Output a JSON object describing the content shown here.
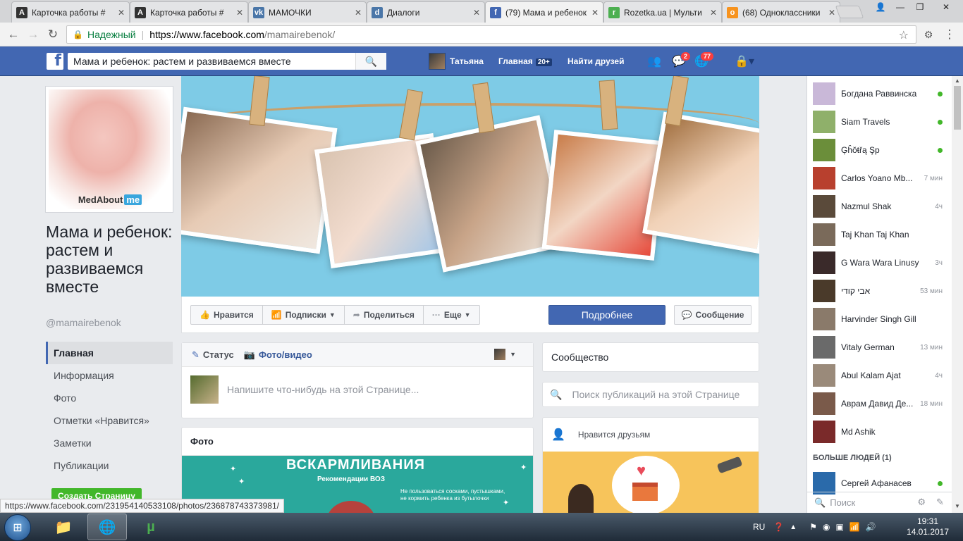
{
  "browser": {
    "tabs": [
      {
        "title": "Карточка работы #",
        "icon": "A",
        "color": "#333333"
      },
      {
        "title": "Карточка работы #",
        "icon": "A",
        "color": "#333333"
      },
      {
        "title": "МАМОЧКИ",
        "icon": "vk",
        "color": "#4a76a8"
      },
      {
        "title": "Диалоги",
        "icon": "d",
        "color": "#4a76a8"
      },
      {
        "title": "(79) Мама и ребенок",
        "icon": "f",
        "color": "#4267b2"
      },
      {
        "title": "Rozetka.ua | Мульти",
        "icon": "r",
        "color": "#4caf50"
      },
      {
        "title": "(68) Одноклассники",
        "icon": "o",
        "color": "#f7931e"
      }
    ],
    "secure_label": "Надежный",
    "url_host": "https://www.facebook.com",
    "url_path": "/mamairebenok/"
  },
  "fb": {
    "search_value": "Мама и ребенок: растем и развиваемся вместе",
    "user_name": "Татьяна",
    "home_label": "Главная",
    "home_badge": "20+",
    "find_friends": "Найти друзей",
    "messages_badge": "2",
    "notifications_badge": "77"
  },
  "page": {
    "profile_brand": "MedAbout",
    "profile_brand_suffix": "me",
    "name": "Мама и ребенок: растем и развиваемся вместе",
    "handle": "@mamairebenok",
    "nav": [
      "Главная",
      "Информация",
      "Фото",
      "Отметки «Нравится»",
      "Заметки",
      "Публикации"
    ],
    "create_page": "Создать Страницу"
  },
  "actions": {
    "like": "Нравится",
    "follow": "Подписки",
    "share": "Поделиться",
    "more": "Еще",
    "learn_more": "Подробнее",
    "message": "Сообщение"
  },
  "composer": {
    "status": "Статус",
    "photo_video": "Фото/видео",
    "placeholder": "Напишите что-нибудь на этой Странице..."
  },
  "photos": {
    "title": "Фото",
    "heading": "ВСКАРМЛИВАНИЯ",
    "subheading": "Рекомендации ВОЗ",
    "note": "Не пользоваться сосками, пустышками, не кормить ребенка из бутылочки"
  },
  "right": {
    "community": "Сообщество",
    "search_posts": "Поиск публикаций на этой Странице",
    "friends_like": "Нравится друзьям"
  },
  "chat": {
    "contacts": [
      {
        "name": "Богдана Раввинска",
        "status": "",
        "online": true,
        "color": "#c9b8d8"
      },
      {
        "name": "Siam Travels",
        "status": "",
        "online": true,
        "color": "#8fb06a"
      },
      {
        "name": "Ģĥŏŧřą Şp",
        "status": "",
        "online": true,
        "color": "#6b8e3a"
      },
      {
        "name": "Carlos Yoano Mb...",
        "status": "7 мин",
        "online": false,
        "color": "#b8402e"
      },
      {
        "name": "Nazmul Shak",
        "status": "4ч",
        "online": false,
        "color": "#5a4a3a"
      },
      {
        "name": "Taj Khan Taj Khan",
        "status": "",
        "online": false,
        "color": "#7a6a5a"
      },
      {
        "name": "G Wara Wara Linusy",
        "status": "3ч",
        "online": false,
        "color": "#3a2a2a"
      },
      {
        "name": "אבי קודי",
        "status": "53 мин",
        "online": false,
        "color": "#4a3a2a"
      },
      {
        "name": "Harvinder Singh Gill",
        "status": "",
        "online": false,
        "color": "#8a7a6a"
      },
      {
        "name": "Vitaly German",
        "status": "13 мин",
        "online": false,
        "color": "#6a6a6a"
      },
      {
        "name": "Abul Kalam Ajat",
        "status": "4ч",
        "online": false,
        "color": "#9a8a7a"
      },
      {
        "name": "Аврам Давид Де...",
        "status": "18 мин",
        "online": false,
        "color": "#7a5a4a"
      },
      {
        "name": "Md Ashik",
        "status": "",
        "online": false,
        "color": "#7a2a2a"
      }
    ],
    "more_people": "БОЛЬШЕ ЛЮДЕЙ (1)",
    "extra": {
      "name": "Сергей Афанасев",
      "online": true,
      "color": "#2a6aaa"
    },
    "search_placeholder": "Поиск"
  },
  "status_bar_url": "https://www.facebook.com/231954140533108/photos/236878743373981/",
  "taskbar": {
    "lang": "RU",
    "time": "19:31",
    "date": "14.01.2017"
  }
}
